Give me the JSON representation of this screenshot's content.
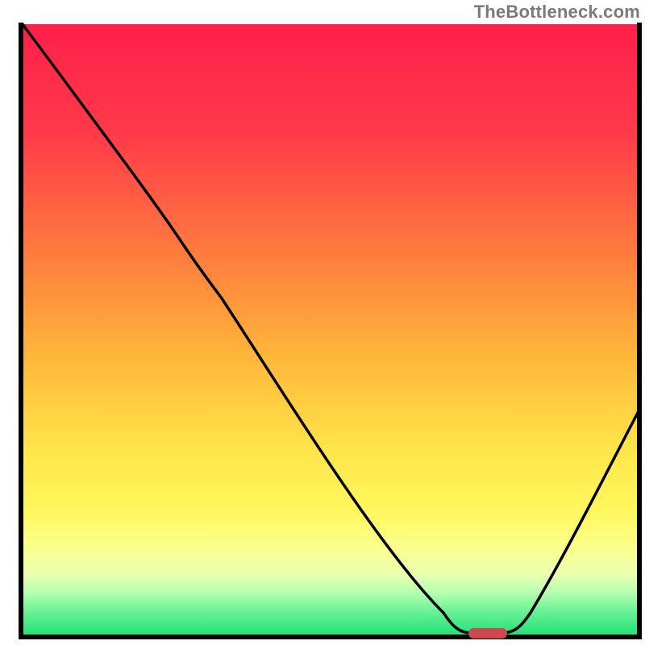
{
  "watermark": "TheBottleneck.com",
  "colors": {
    "curve": "#000000",
    "marker": "#d0484f",
    "gradient_top": "#ff1f4b",
    "gradient_bottom": "#20e07a"
  },
  "chart_data": {
    "type": "line",
    "title": "",
    "xlabel": "",
    "ylabel": "",
    "xlim": [
      0,
      100
    ],
    "ylim": [
      0,
      100
    ],
    "x": [
      0,
      8,
      15,
      22,
      26,
      30,
      38,
      50,
      62,
      69,
      73,
      77,
      80,
      86,
      93,
      100
    ],
    "values": [
      100,
      90,
      78,
      68,
      61,
      56,
      46,
      30,
      14,
      4,
      0,
      0,
      2,
      12,
      25,
      37
    ],
    "marker": {
      "x_range": [
        73,
        79
      ],
      "y": 0
    },
    "note": "Axes have no tick labels in the source image; values are read proportionally from pixel positions."
  }
}
